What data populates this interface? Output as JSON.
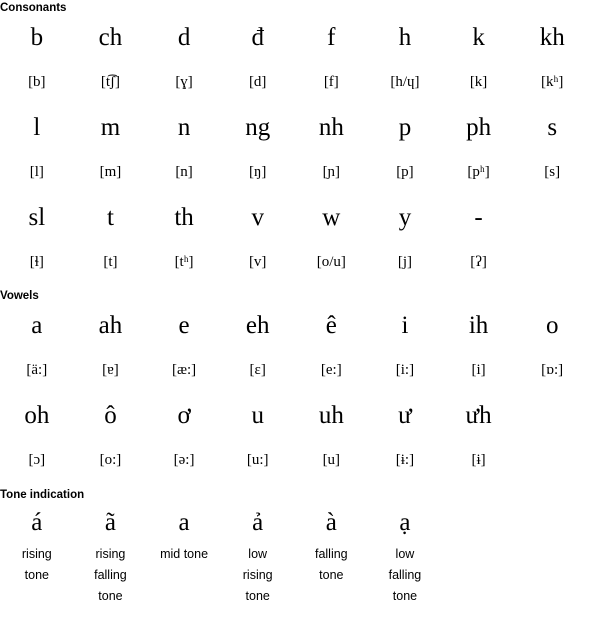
{
  "sections": {
    "consonants": {
      "header": "Consonants",
      "rows": [
        {
          "letters": [
            "b",
            "ch",
            "d",
            "đ",
            "f",
            "h",
            "k",
            "kh"
          ],
          "ipa": [
            "[b]",
            "[t͡ʃ]",
            "[ɣ]",
            "[d]",
            "[f]",
            "[h/ɥ]",
            "[k]",
            "[kʰ]"
          ]
        },
        {
          "letters": [
            "l",
            "m",
            "n",
            "ng",
            "nh",
            "p",
            "ph",
            "s"
          ],
          "ipa": [
            "[l]",
            "[m]",
            "[n]",
            "[ŋ]",
            "[ɲ]",
            "[p]",
            "[pʰ]",
            "[s]"
          ]
        },
        {
          "letters": [
            "sl",
            "t",
            "th",
            "v",
            "w",
            "y",
            "-",
            ""
          ],
          "ipa": [
            "[ɬ]",
            "[t]",
            "[tʰ]",
            "[v]",
            "[o/u]",
            "[j]",
            "[ʔ]",
            ""
          ]
        }
      ]
    },
    "vowels": {
      "header": "Vowels",
      "rows": [
        {
          "letters": [
            "a",
            "ah",
            "e",
            "eh",
            "ê",
            "i",
            "ih",
            "o"
          ],
          "ipa": [
            "[ä:]",
            "[ɐ]",
            "[æ:]",
            "[ɛ]",
            "[e:]",
            "[i:]",
            "[i]",
            "[ɒ:]"
          ]
        },
        {
          "letters": [
            "oh",
            "ô",
            "ơ",
            "u",
            "uh",
            "ư",
            "ưh",
            ""
          ],
          "ipa": [
            "[ɔ]",
            "[o:]",
            "[ə:]",
            "[u:]",
            "[u]",
            "[ɨ:]",
            "[ɨ]",
            ""
          ]
        }
      ]
    },
    "tones": {
      "header": "Tone indication",
      "items": [
        {
          "letter": "á",
          "description_lines": [
            "rising",
            "tone"
          ]
        },
        {
          "letter": "ã",
          "description_lines": [
            "rising",
            "falling",
            "tone"
          ]
        },
        {
          "letter": "a",
          "description_lines": [
            "mid tone"
          ]
        },
        {
          "letter": "ả",
          "description_lines": [
            "low",
            "rising",
            "tone"
          ]
        },
        {
          "letter": "à",
          "description_lines": [
            "falling",
            "tone"
          ]
        },
        {
          "letter": "ạ",
          "description_lines": [
            "low",
            "falling",
            "tone"
          ]
        },
        {
          "letter": "",
          "description_lines": []
        },
        {
          "letter": "",
          "description_lines": []
        }
      ]
    }
  },
  "colors": {
    "background": "#ffffff",
    "text": "#000000"
  }
}
